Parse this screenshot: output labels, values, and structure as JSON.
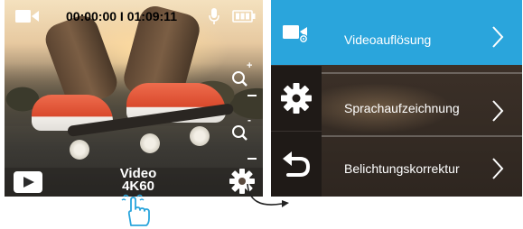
{
  "live_view": {
    "timecode": "00:00:00 I 01:09:11",
    "mode_line1": "Video",
    "mode_line2": "4K60",
    "zoom_in_symbol": "+",
    "zoom_out_symbol": "-",
    "icons": [
      "video-camera-icon",
      "microphone-icon",
      "battery-icon",
      "zoom-in-icon",
      "zoom-out-icon",
      "playback-icon",
      "gear-icon"
    ]
  },
  "settings_menu": {
    "items": [
      {
        "label": "Videoauflösung",
        "icon": "video-settings-icon",
        "active": true
      },
      {
        "label": "Sprachaufzeichnung",
        "icon": "gear-icon",
        "active": false
      },
      {
        "label": "Belichtungskorrektur",
        "icon": "back-arrow-icon",
        "active": false
      }
    ]
  },
  "colors": {
    "accent": "#2aa5dc",
    "sidebar": "#1f1a17",
    "text": "#ffffff"
  }
}
